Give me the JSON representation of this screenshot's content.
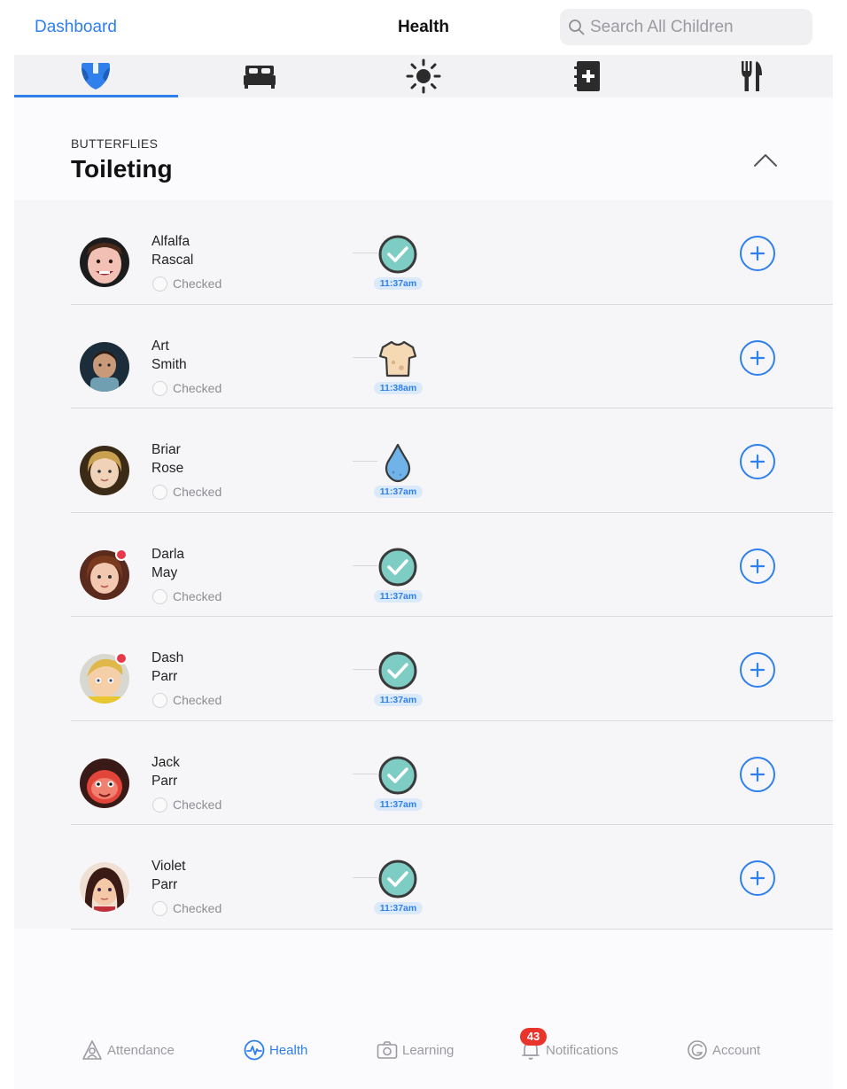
{
  "navbar": {
    "back_label": "Dashboard",
    "title": "Health",
    "search_placeholder": "Search All Children"
  },
  "category_tabs": [
    {
      "icon": "diaper-icon",
      "active": true
    },
    {
      "icon": "bed-icon",
      "active": false
    },
    {
      "icon": "sun-icon",
      "active": false
    },
    {
      "icon": "medical-notebook-icon",
      "active": false
    },
    {
      "icon": "fork-knife-icon",
      "active": false
    }
  ],
  "section": {
    "group": "BUTTERFLIES",
    "title": "Toileting"
  },
  "children": [
    {
      "first": "Alfalfa",
      "last": "Rascal",
      "checked_label": "Checked",
      "event": "checkmark",
      "time": "11:37am",
      "favorite": false
    },
    {
      "first": "Art",
      "last": "Smith",
      "checked_label": "Checked",
      "event": "shirt",
      "time": "11:38am",
      "favorite": false
    },
    {
      "first": "Briar",
      "last": "Rose",
      "checked_label": "Checked",
      "event": "droplet",
      "time": "11:37am",
      "favorite": false
    },
    {
      "first": "Darla",
      "last": "May",
      "checked_label": "Checked",
      "event": "checkmark",
      "time": "11:37am",
      "favorite": true
    },
    {
      "first": "Dash",
      "last": "Parr",
      "checked_label": "Checked",
      "event": "checkmark",
      "time": "11:37am",
      "favorite": true
    },
    {
      "first": "Jack",
      "last": "Parr",
      "checked_label": "Checked",
      "event": "checkmark",
      "time": "11:37am",
      "favorite": false
    },
    {
      "first": "Violet",
      "last": "Parr",
      "checked_label": "Checked",
      "event": "checkmark",
      "time": "11:37am",
      "favorite": false
    }
  ],
  "tabbar": [
    {
      "label": "Attendance",
      "icon": "attendance-icon",
      "active": false
    },
    {
      "label": "Health",
      "icon": "health-icon",
      "active": true
    },
    {
      "label": "Learning",
      "icon": "camera-icon",
      "active": false
    },
    {
      "label": "Notifications",
      "icon": "bell-icon",
      "active": false,
      "badge": "43"
    },
    {
      "label": "Account",
      "icon": "account-icon",
      "active": false
    }
  ],
  "colors": {
    "accent": "#2f80ed",
    "check_fill": "#7ecdc4",
    "badge": "#e8342a"
  }
}
